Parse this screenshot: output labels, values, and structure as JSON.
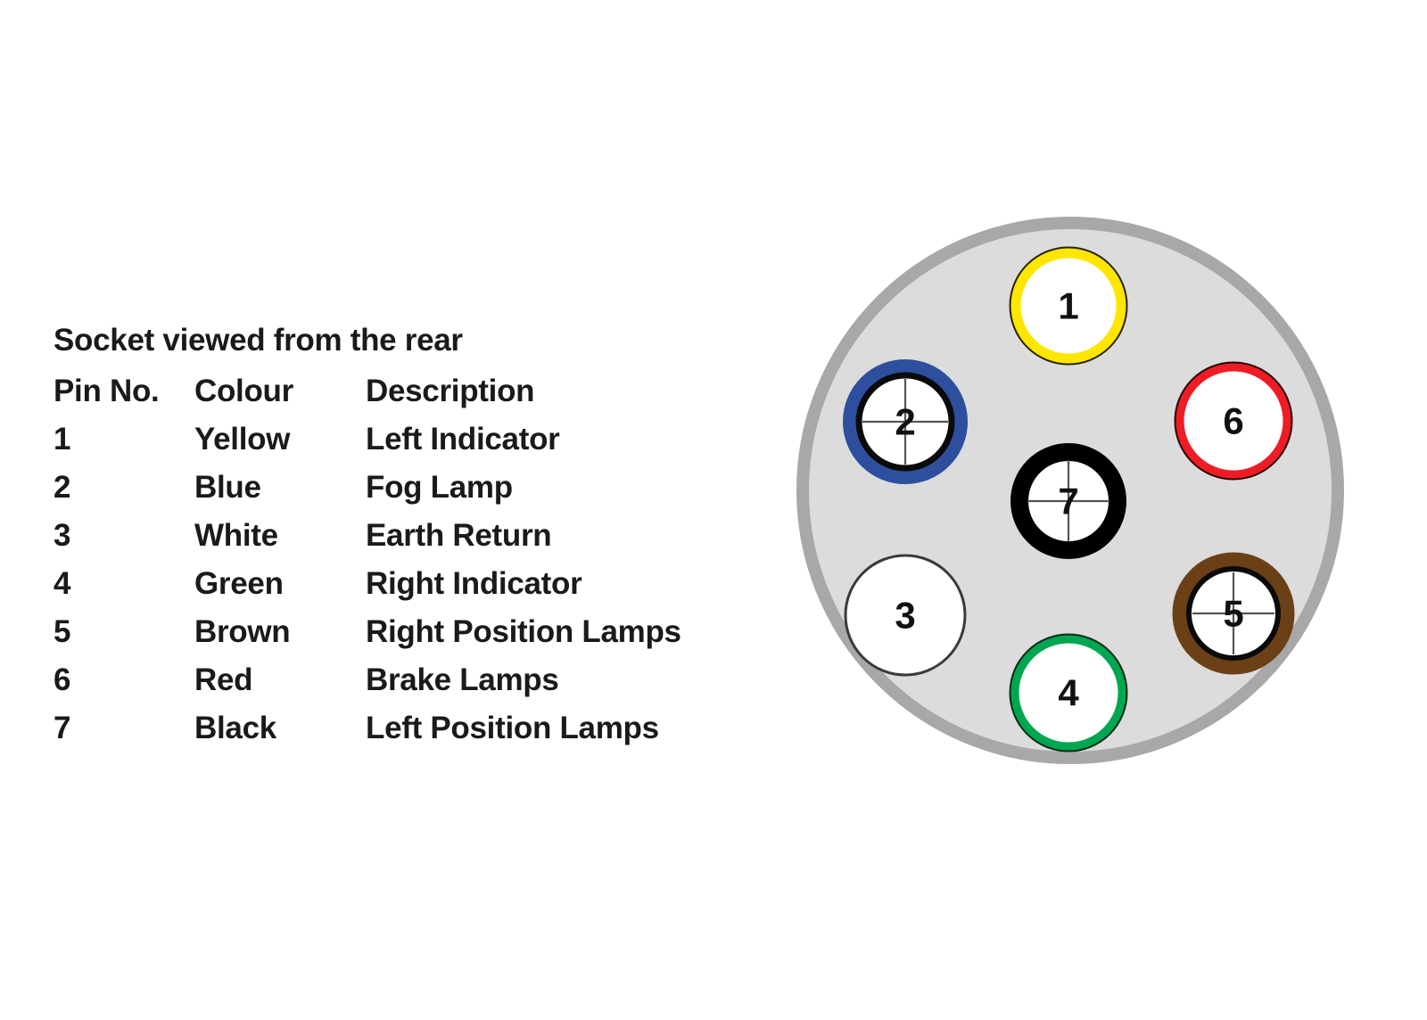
{
  "legend": {
    "title": "Socket viewed from the rear",
    "headers": {
      "pin": "Pin No.",
      "colour": "Colour",
      "description": "Description"
    },
    "rows": [
      {
        "pin": "1",
        "colour": "Yellow",
        "description": "Left Indicator"
      },
      {
        "pin": "2",
        "colour": "Blue",
        "description": "Fog Lamp"
      },
      {
        "pin": "3",
        "colour": "White",
        "description": "Earth Return"
      },
      {
        "pin": "4",
        "colour": "Green",
        "description": "Right Indicator"
      },
      {
        "pin": "5",
        "colour": "Brown",
        "description": "Right Position Lamps"
      },
      {
        "pin": "6",
        "colour": "Red",
        "description": "Brake Lamps"
      },
      {
        "pin": "7",
        "colour": "Black",
        "description": "Left Position Lamps"
      }
    ]
  },
  "socket": {
    "body_fill": "#dcdcdc",
    "body_rim": "#a8a8a8",
    "pins": [
      {
        "number": "1",
        "colour_name": "Yellow",
        "ring_color": "#ffe600",
        "crosshair": false
      },
      {
        "number": "2",
        "colour_name": "Blue",
        "ring_color": "#2e4f9e",
        "crosshair": true
      },
      {
        "number": "3",
        "colour_name": "White",
        "ring_color": "#ffffff",
        "crosshair": false
      },
      {
        "number": "4",
        "colour_name": "Green",
        "ring_color": "#00a650",
        "crosshair": false
      },
      {
        "number": "5",
        "colour_name": "Brown",
        "ring_color": "#6b4016",
        "crosshair": true
      },
      {
        "number": "6",
        "colour_name": "Red",
        "ring_color": "#ee1c24",
        "crosshair": false
      },
      {
        "number": "7",
        "colour_name": "Black",
        "ring_color": "#000000",
        "crosshair": true
      }
    ]
  }
}
